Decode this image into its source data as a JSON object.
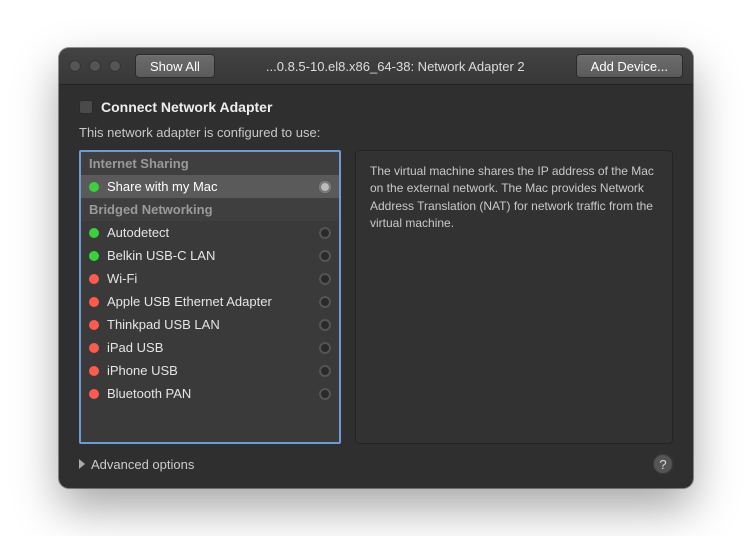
{
  "toolbar": {
    "show_all": "Show All",
    "title": "...0.8.5-10.el8.x86_64-38: Network Adapter 2",
    "add_device": "Add Device..."
  },
  "connect": {
    "label": "Connect Network Adapter",
    "checked": false
  },
  "subtext": "This network adapter is configured to use:",
  "groups": [
    {
      "title": "Internet Sharing",
      "items": [
        {
          "label": "Share with my Mac",
          "status": "green",
          "selected": true
        }
      ]
    },
    {
      "title": "Bridged Networking",
      "items": [
        {
          "label": "Autodetect",
          "status": "green",
          "selected": false
        },
        {
          "label": "Belkin USB-C LAN",
          "status": "green",
          "selected": false
        },
        {
          "label": "Wi-Fi",
          "status": "red",
          "selected": false
        },
        {
          "label": "Apple USB Ethernet Adapter",
          "status": "red",
          "selected": false
        },
        {
          "label": "Thinkpad USB LAN",
          "status": "red",
          "selected": false
        },
        {
          "label": "iPad USB",
          "status": "red",
          "selected": false
        },
        {
          "label": "iPhone USB",
          "status": "red",
          "selected": false
        },
        {
          "label": "Bluetooth PAN",
          "status": "red",
          "selected": false
        }
      ]
    }
  ],
  "info_text": "The virtual machine shares the IP address of the Mac on the external network. The Mac provides Network Address Translation (NAT) for network traffic from the virtual machine.",
  "advanced": "Advanced options",
  "help": "?"
}
